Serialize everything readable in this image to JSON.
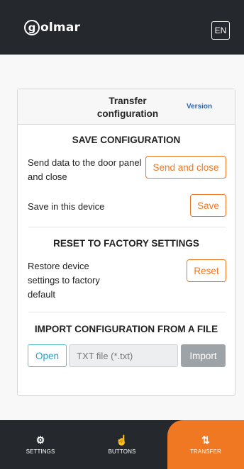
{
  "header": {
    "logo_first": "g",
    "logo_rest": "olmar",
    "language_button": "EN"
  },
  "card": {
    "title": "Transfer configuration",
    "version_link": "Version",
    "save_section": {
      "title": "SAVE CONFIGURATION",
      "send_text": "Send data to the door panel and close",
      "send_button": "Send and close",
      "save_text": "Save in this device",
      "save_button": "Save"
    },
    "reset_section": {
      "title": "RESET TO FACTORY SETTINGS",
      "reset_text": "Restore device settings to factory default",
      "reset_button": "Reset"
    },
    "import_section": {
      "title": "IMPORT CONFIGURATION FROM A FILE",
      "open_button": "Open",
      "file_placeholder": "TXT file (*.txt)",
      "import_button": "Import"
    }
  },
  "bottom_nav": {
    "items": [
      {
        "label": "SETTINGS",
        "icon": "settings-icon"
      },
      {
        "label": "BUTTONS",
        "icon": "hand-pointer-icon"
      },
      {
        "label": "TRANSFER",
        "icon": "transfer-arrows-icon",
        "active": true
      }
    ]
  },
  "colors": {
    "accent": "#f07822",
    "dark_bar": "#25282c",
    "link_blue": "#2f64b0",
    "open_button": "#2aa3bf",
    "import_disabled": "#9ea3a7"
  }
}
